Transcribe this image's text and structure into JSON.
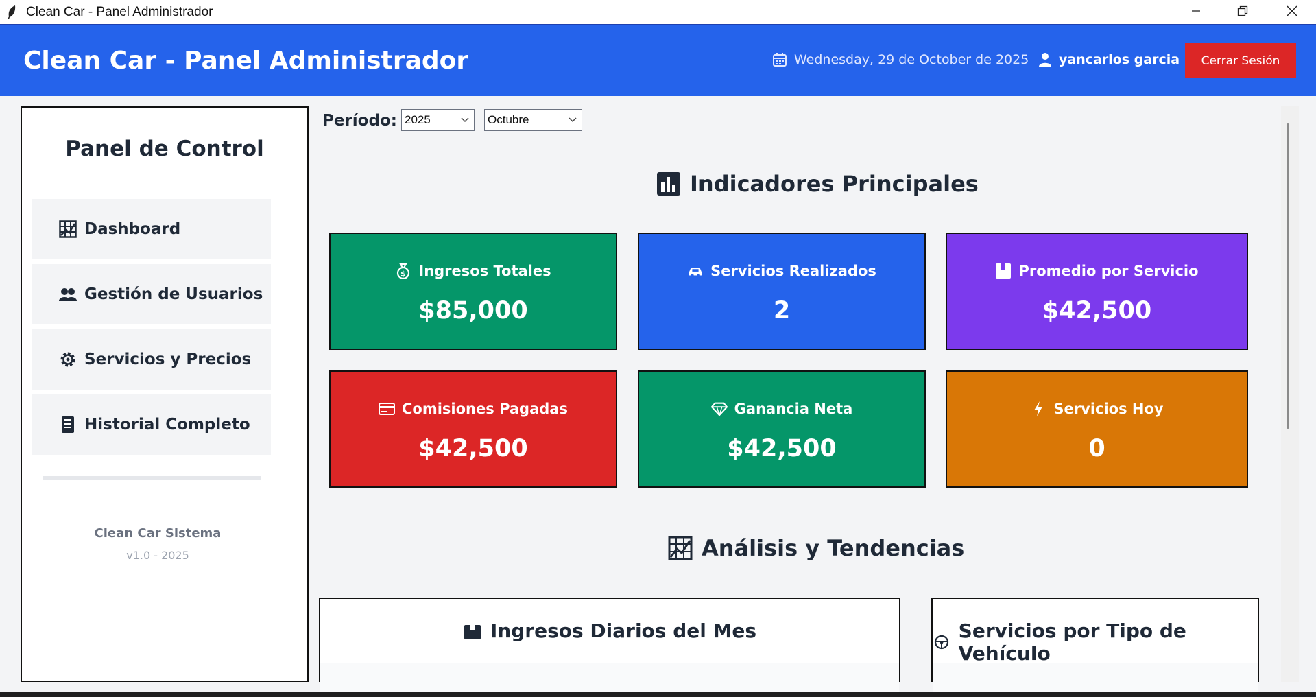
{
  "window": {
    "title": "Clean Car - Panel Administrador",
    "icons": [
      "feather-icon",
      "minimize-icon",
      "maximize-icon",
      "close-icon"
    ]
  },
  "header": {
    "title": "Clean Car - Panel Administrador",
    "date": "Wednesday, 29 de October de 2025",
    "user": "yancarlos garcia",
    "logout_label": "Cerrar Sesión",
    "background": "#2563eb",
    "logout_color": "#dc2626"
  },
  "sidebar": {
    "title": "Panel de Control",
    "items": [
      {
        "label": "Dashboard",
        "icon": "chart-grid-icon"
      },
      {
        "label": "Gestión de Usuarios",
        "icon": "users-icon"
      },
      {
        "label": "Servicios y Precios",
        "icon": "gear-icon"
      },
      {
        "label": "Historial Completo",
        "icon": "ledger-icon"
      }
    ],
    "footer_name": "Clean Car Sistema",
    "footer_version": "v1.0 - 2025"
  },
  "filters": {
    "label": "Período:",
    "year": "2025",
    "month": "Octubre"
  },
  "indicators": {
    "title": "Indicadores Principales",
    "icon": "bar-chart-icon",
    "cards": [
      {
        "label": "Ingresos Totales",
        "value": "$85,000",
        "icon": "money-bag-icon",
        "color": "#059669"
      },
      {
        "label": "Servicios Realizados",
        "value": "2",
        "icon": "car-icon",
        "color": "#2563eb"
      },
      {
        "label": "Promedio por Servicio",
        "value": "$42,500",
        "icon": "box-icon",
        "color": "#7c3aed"
      },
      {
        "label": "Comisiones Pagadas",
        "value": "$42,500",
        "icon": "credit-card-icon",
        "color": "#dc2626"
      },
      {
        "label": "Ganancia Neta",
        "value": "$42,500",
        "icon": "diamond-icon",
        "color": "#059669"
      },
      {
        "label": "Servicios Hoy",
        "value": "0",
        "icon": "lightning-icon",
        "color": "#d97706"
      }
    ]
  },
  "analysis": {
    "title": "Análisis y Tendencias",
    "icon": "trend-chart-icon",
    "panels": [
      {
        "title": "Ingresos Diarios del Mes",
        "icon": "box-icon"
      },
      {
        "title": "Servicios por Tipo de Vehículo",
        "icon": "steering-wheel-icon"
      }
    ]
  }
}
